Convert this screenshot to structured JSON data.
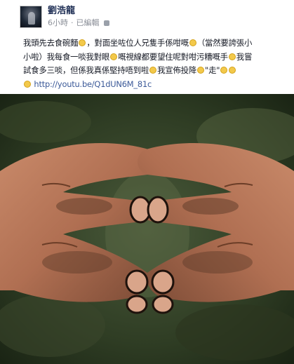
{
  "author": {
    "name": "劉浩龍",
    "time": "6小時",
    "edited": "已編輯"
  },
  "post": {
    "lines": [
      "我頭先去食碗麵",
      "，對面坐咗位人兄隻手係咁嘅",
      "（當然要誇張小",
      "小啦）我每食一啖我對眼",
      "嘅視線都要望住呢對咁污糟嘅手",
      "我嘗",
      "試食多三啖，但係我真係堅持唔到啦",
      "我宣佈投降",
      "\"走\""
    ],
    "link": "http://youtu.be/Q1dUN6M_81c"
  },
  "photo": {
    "subject": "two dirty hands forming a heart shape with fingertips touching"
  },
  "colors": {
    "author": "#1f2f55",
    "link": "#3b5998",
    "text": "#141823",
    "meta": "#8b8f98"
  }
}
